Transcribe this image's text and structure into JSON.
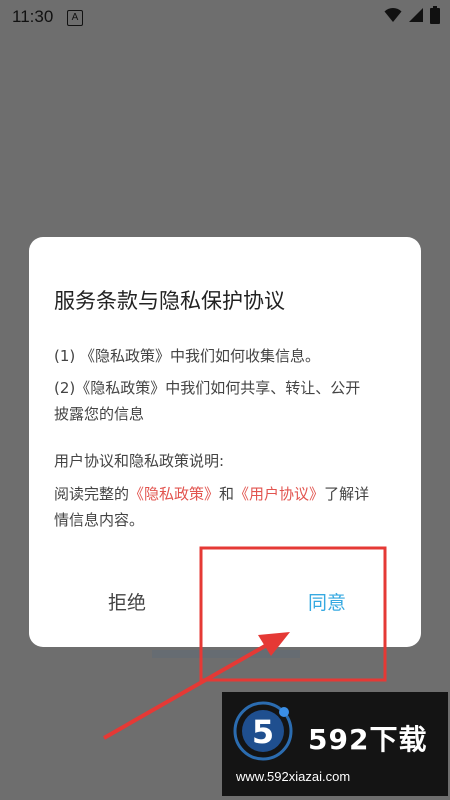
{
  "status_bar": {
    "time": "11:30",
    "notification_letter": "A"
  },
  "dialog": {
    "title": "服务条款与隐私保护协议",
    "item1": "(1) 《隐私政策》中我们如何收集信息。",
    "item2_line1": "(2)《隐私政策》中我们如何共享、转让、公开",
    "item2_line2": "披露您的信息",
    "note_heading": "用户协议和隐私政策说明:",
    "read_prefix": "阅读完整的",
    "privacy_link": "《隐私政策》",
    "and_text": "和",
    "user_agreement_link": "《用户协议》",
    "read_suffix": "了解详",
    "read_line2": "情信息内容。",
    "decline_label": "拒绝",
    "agree_label": "同意"
  },
  "watermark": {
    "logo_digit": "5",
    "brand": "592下载",
    "url": "www.592xiazai.com"
  },
  "colors": {
    "overlay": "#6e6e6e",
    "link": "#e2544f",
    "agree": "#36a9e1",
    "annotation": "#e53935"
  },
  "icons": [
    "wifi-icon",
    "signal-icon",
    "battery-icon"
  ]
}
